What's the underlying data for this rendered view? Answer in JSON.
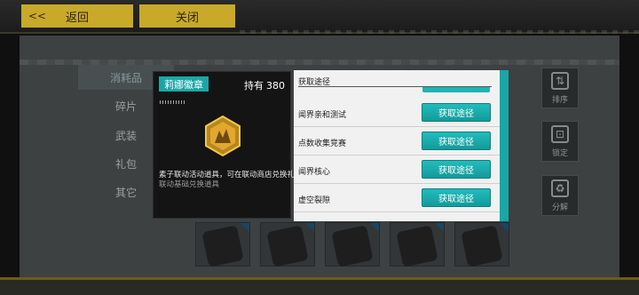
{
  "topbar": {
    "back_arrows": "<<",
    "back_label": "返回",
    "close_label": "关闭"
  },
  "categories": [
    {
      "label": "消耗品",
      "active": true
    },
    {
      "label": "碎片",
      "active": false
    },
    {
      "label": "武装",
      "active": false
    },
    {
      "label": "礼包",
      "active": false
    },
    {
      "label": "其它",
      "active": false
    }
  ],
  "side_buttons": {
    "sort": {
      "label": "排序",
      "icon": "sort-icon"
    },
    "lock": {
      "label": "锁定",
      "icon": "lock-icon"
    },
    "decompose": {
      "label": "分解",
      "icon": "recycle-icon"
    }
  },
  "detail": {
    "item_name": "莉娜徽章",
    "owned_label": "持有",
    "owned_count": "380",
    "icon": "hexagon-badge-icon",
    "desc_line1": "素子联动活动道具，可在联动商店兑换礼品",
    "desc_line2": "联动基础兑换道具"
  },
  "source": {
    "title": "获取途径",
    "rows": [
      {
        "name": "闻界亲和测试",
        "button": "获取途径"
      },
      {
        "name": "点数收集竞赛",
        "button": "获取途径"
      },
      {
        "name": "闻界核心",
        "button": "获取途径"
      },
      {
        "name": "虚空裂隙",
        "button": "获取途径"
      }
    ]
  },
  "colors": {
    "accent_teal": "#1aa6a6",
    "topbar_gold": "#c8a92a"
  }
}
